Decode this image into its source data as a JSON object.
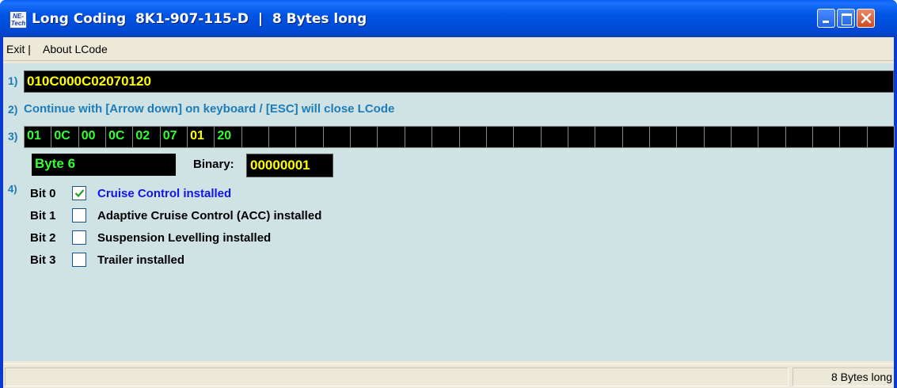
{
  "window": {
    "title": "Long Coding  8K1-907-115-D  |  8 Bytes long",
    "icon_text": "NE-Tech"
  },
  "menu": {
    "exit": "Exit |",
    "about": "About LCode"
  },
  "step1": {
    "num": "1)",
    "code": "010C000C02070120"
  },
  "step2": {
    "num": "2)",
    "hint": "Continue with [Arrow down] on keyboard / [ESC] will close LCode"
  },
  "step3": {
    "num": "3)",
    "bytes": [
      "01",
      "0C",
      "00",
      "0C",
      "02",
      "07",
      "01",
      "20"
    ],
    "selected_index": 6,
    "empty_cells": 24,
    "byte_label": "Byte 6",
    "binary_label": "Binary:",
    "binary_value": "00000001"
  },
  "step4": {
    "num": "4)",
    "bits": [
      {
        "name": "Bit 0",
        "desc": "Cruise Control installed",
        "checked": true
      },
      {
        "name": "Bit 1",
        "desc": "Adaptive Cruise Control (ACC) installed",
        "checked": false
      },
      {
        "name": "Bit 2",
        "desc": "Suspension Levelling installed",
        "checked": false
      },
      {
        "name": "Bit 3",
        "desc": "Trailer installed",
        "checked": false
      }
    ]
  },
  "status": {
    "right": "8 Bytes long"
  },
  "colors": {
    "panel_bg": "#cfe2e4",
    "accent_blue": "#1d7cb8",
    "code_yellow": "#ffff00",
    "byte_green": "#33ff33",
    "checked_text": "#1014e8"
  }
}
